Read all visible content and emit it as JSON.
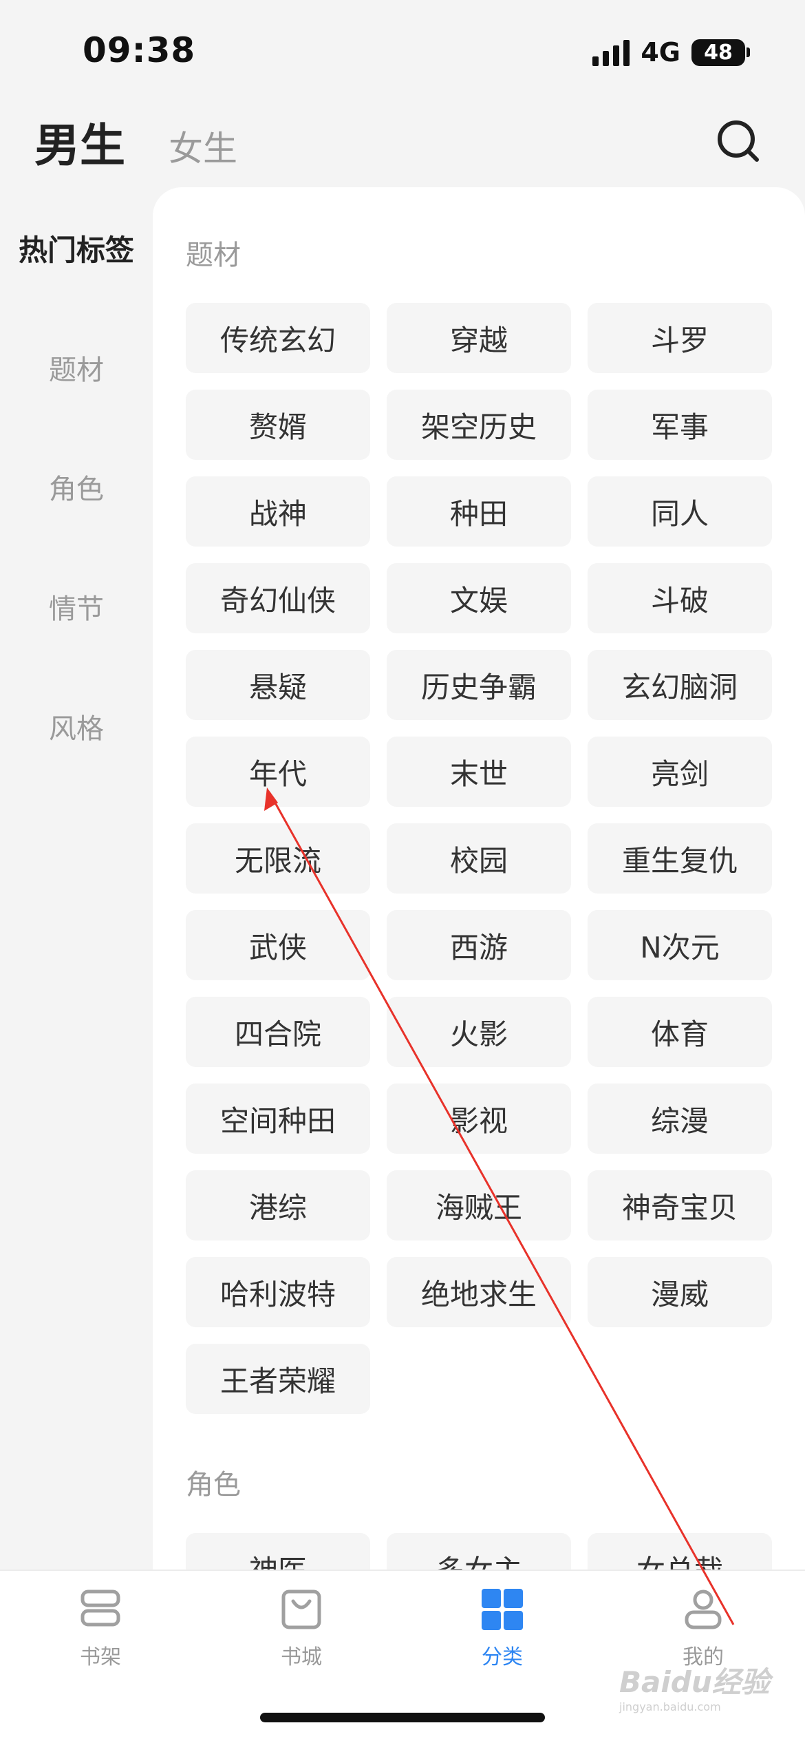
{
  "status_bar": {
    "time": "09:38",
    "network": "4G",
    "battery": "48"
  },
  "header": {
    "tab_male": "男生",
    "tab_female": "女生",
    "search_icon": "search-icon"
  },
  "sidebar": {
    "items": [
      {
        "label": "热门标签",
        "active": true
      },
      {
        "label": "题材",
        "active": false
      },
      {
        "label": "角色",
        "active": false
      },
      {
        "label": "情节",
        "active": false
      },
      {
        "label": "风格",
        "active": false
      }
    ]
  },
  "sections": [
    {
      "title": "题材",
      "tags": [
        "传统玄幻",
        "穿越",
        "斗罗",
        "赘婿",
        "架空历史",
        "军事",
        "战神",
        "种田",
        "同人",
        "奇幻仙侠",
        "文娱",
        "斗破",
        "悬疑",
        "历史争霸",
        "玄幻脑洞",
        "年代",
        "末世",
        "亮剑",
        "无限流",
        "校园",
        "重生复仇",
        "武侠",
        "西游",
        "N次元",
        "四合院",
        "火影",
        "体育",
        "空间种田",
        "影视",
        "综漫",
        "港综",
        "海贼王",
        "神奇宝贝",
        "哈利波特",
        "绝地求生",
        "漫威",
        "王者荣耀"
      ]
    },
    {
      "title": "角色",
      "tags": [
        "神医",
        "多女主",
        "女总裁"
      ]
    }
  ],
  "bottom_nav": {
    "items": [
      {
        "label": "书架",
        "icon": "bookshelf-icon",
        "active": false
      },
      {
        "label": "书城",
        "icon": "bookstore-icon",
        "active": false
      },
      {
        "label": "分类",
        "icon": "category-grid-icon",
        "active": true
      },
      {
        "label": "我的",
        "icon": "profile-icon",
        "active": false
      }
    ]
  },
  "colors": {
    "accent": "#2e86f2",
    "annotation_arrow": "#e8322a",
    "tag_bg": "#f5f5f5",
    "page_bg": "#f4f4f4"
  },
  "watermark": {
    "text": "Baidu经验",
    "sub": "jingyan.baidu.com"
  }
}
